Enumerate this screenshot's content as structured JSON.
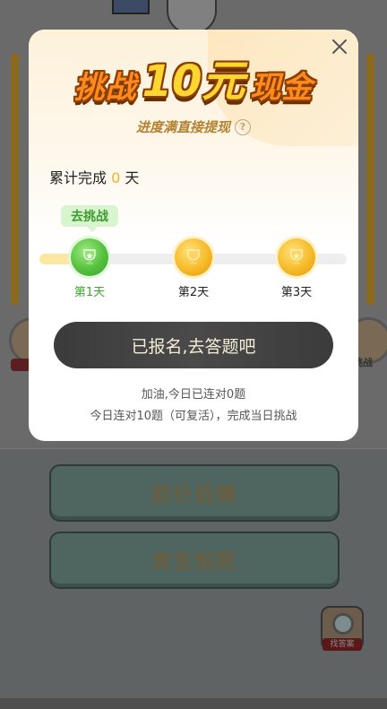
{
  "background": {
    "answer_options": [
      "前仆后继",
      "贪生怕死"
    ],
    "side_right_label": "挑战",
    "helper_label": "找答案"
  },
  "modal": {
    "title_left": "挑战",
    "title_amount": "10元",
    "title_right": "现金",
    "subtitle": "进度满直接提现",
    "help_symbol": "?",
    "progress_prefix": "累计完成",
    "progress_value": "0",
    "progress_suffix": "天",
    "go_badge": "去挑战",
    "days": [
      {
        "label": "第1天",
        "state": "active"
      },
      {
        "label": "第2天",
        "state": "locked"
      },
      {
        "label": "第3天",
        "state": "locked"
      }
    ],
    "signup_button": "已报名,去答题吧",
    "tip_line1": "加油,今日已连对0题",
    "tip_line2": "今日连对10题（可复活），完成当日挑战"
  },
  "colors": {
    "accent_orange": "#ff8a1e",
    "accent_gold": "#ffd630",
    "active_green": "#3fa52e",
    "button_dark": "#3b3b3b"
  },
  "icons": {
    "close": "close-icon",
    "help": "question-icon",
    "day_active": "star-trophy-icon",
    "day_locked": "trophy-icon"
  }
}
